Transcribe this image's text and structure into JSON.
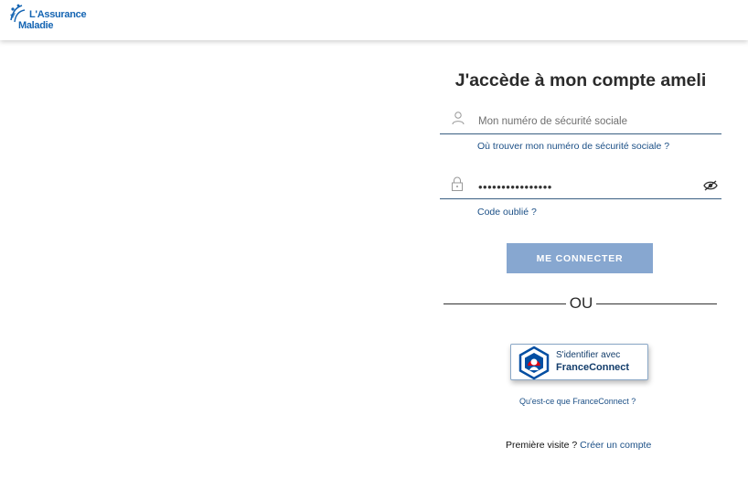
{
  "header": {
    "logo": {
      "line1": "L'Assurance",
      "line2": "Maladie"
    }
  },
  "login": {
    "title": "J'accède à mon compte ameli",
    "nss_placeholder": "Mon numéro de sécurité sociale",
    "nss_help_link": "Où trouver mon numéro de sécurité sociale ?",
    "password_value": "••••••••••••••••",
    "forgot_code_link": "Code oublié ?",
    "connect_button": "ME CONNECTER",
    "separator": "OU",
    "franceconnect": {
      "line1": "S'identifier avec",
      "line2": "FranceConnect",
      "help_link": "Qu'est-ce que FranceConnect ?"
    },
    "first_visit_text": "Première visite ? ",
    "create_account_link": "Créer un compte"
  },
  "icons": {
    "user": "user-icon",
    "lock": "lock-icon",
    "eye": "eye-slash-icon",
    "franceconnect": "franceconnect-logo"
  },
  "colors": {
    "brand_blue": "#1565b3",
    "link": "#1b4f86",
    "button_disabled": "#87a7d0",
    "field_border": "#3a5f82",
    "fc_red": "#e1000f",
    "fc_blue": "#034ea2"
  }
}
